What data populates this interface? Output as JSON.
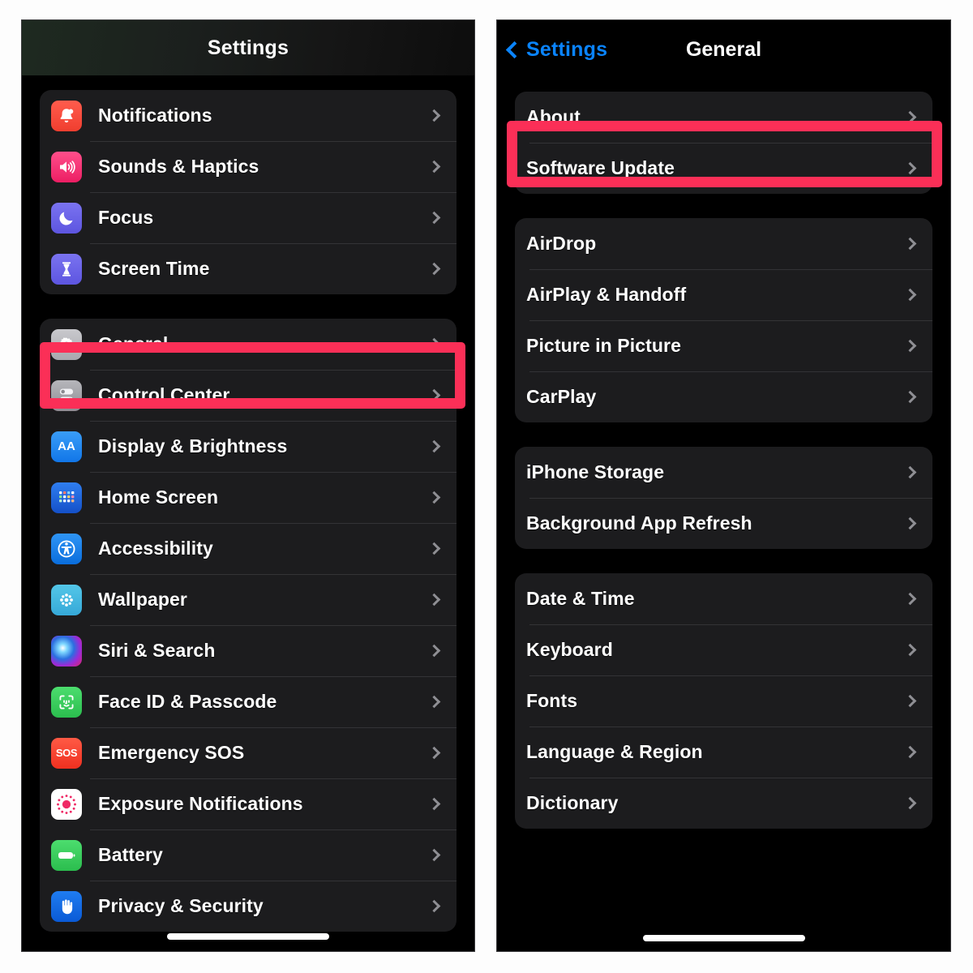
{
  "left_screen": {
    "nav_title": "Settings",
    "groups": [
      {
        "name": "alerts-group",
        "items": [
          {
            "label": "Notifications",
            "icon": "notifications-icon"
          },
          {
            "label": "Sounds & Haptics",
            "icon": "sounds-haptics-icon"
          },
          {
            "label": "Focus",
            "icon": "focus-icon"
          },
          {
            "label": "Screen Time",
            "icon": "screen-time-icon"
          }
        ]
      },
      {
        "name": "system-group",
        "items": [
          {
            "label": "General",
            "icon": "general-gear-icon"
          },
          {
            "label": "Control Center",
            "icon": "control-center-icon"
          },
          {
            "label": "Display & Brightness",
            "icon": "display-brightness-icon"
          },
          {
            "label": "Home Screen",
            "icon": "home-screen-icon"
          },
          {
            "label": "Accessibility",
            "icon": "accessibility-icon"
          },
          {
            "label": "Wallpaper",
            "icon": "wallpaper-icon"
          },
          {
            "label": "Siri & Search",
            "icon": "siri-search-icon"
          },
          {
            "label": "Face ID & Passcode",
            "icon": "face-id-icon"
          },
          {
            "label": "Emergency SOS",
            "icon": "emergency-sos-icon"
          },
          {
            "label": "Exposure Notifications",
            "icon": "exposure-notifications-icon"
          },
          {
            "label": "Battery",
            "icon": "battery-icon"
          },
          {
            "label": "Privacy & Security",
            "icon": "privacy-security-icon"
          }
        ]
      }
    ],
    "highlighted_item": "General"
  },
  "right_screen": {
    "back_label": "Settings",
    "nav_title": "General",
    "groups": [
      {
        "name": "about-group",
        "items": [
          {
            "label": "About"
          },
          {
            "label": "Software Update"
          }
        ]
      },
      {
        "name": "sharing-group",
        "items": [
          {
            "label": "AirDrop"
          },
          {
            "label": "AirPlay & Handoff"
          },
          {
            "label": "Picture in Picture"
          },
          {
            "label": "CarPlay"
          }
        ]
      },
      {
        "name": "storage-group",
        "items": [
          {
            "label": "iPhone Storage"
          },
          {
            "label": "Background App Refresh"
          }
        ]
      },
      {
        "name": "locale-group",
        "items": [
          {
            "label": "Date & Time"
          },
          {
            "label": "Keyboard"
          },
          {
            "label": "Fonts"
          },
          {
            "label": "Language & Region"
          },
          {
            "label": "Dictionary"
          }
        ]
      }
    ],
    "highlighted_item": "About"
  },
  "colors": {
    "highlight": "#FB2F57",
    "accent_blue": "#0A84FF",
    "cell_background": "#1C1C1E",
    "screen_background": "#000000",
    "chevron": "#8E8E93"
  }
}
